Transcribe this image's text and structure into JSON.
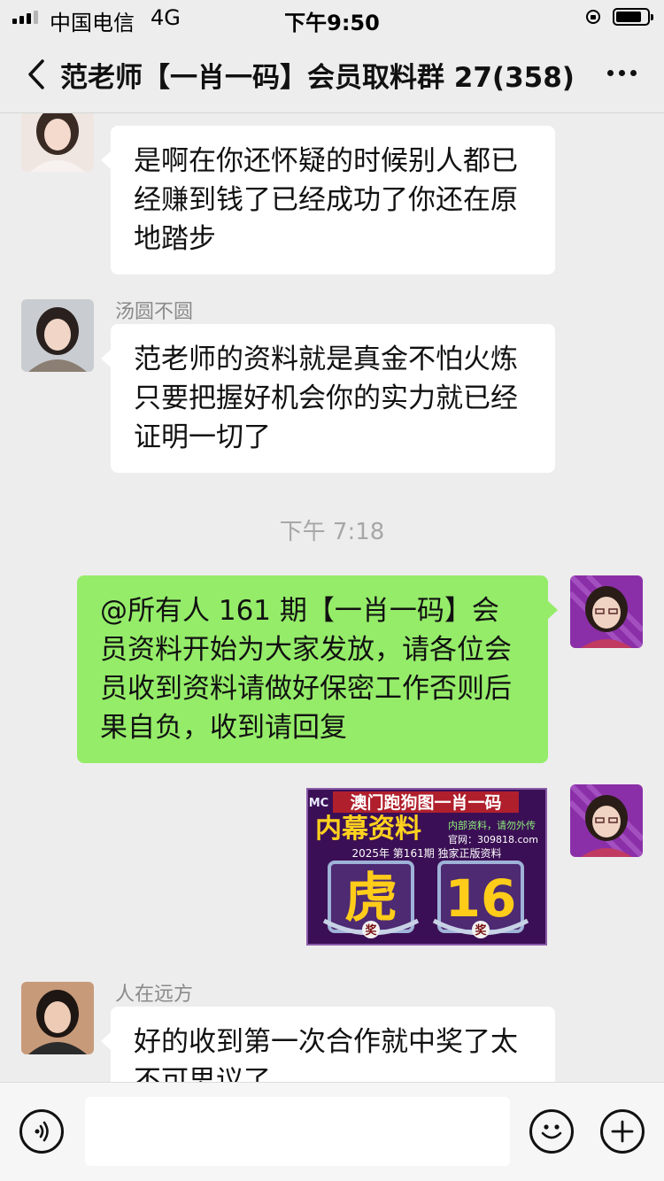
{
  "status_bar": {
    "carrier": "中国电信",
    "network": "4G",
    "time": "下午9:50"
  },
  "header": {
    "title": "范老师【一肖一码】会员取料群 27(358)"
  },
  "messages": [
    {
      "direction": "in",
      "sender": "",
      "text": "是啊在你还怀疑的时候别人都已经赚到钱了已经成功了你还在原地踏步"
    },
    {
      "direction": "in",
      "sender": "汤圆不圆",
      "text": "范老师的资料就是真金不怕火炼只要把握好机会你的实力就已经证明一切了"
    },
    {
      "type": "timestamp",
      "text": "下午 7:18"
    },
    {
      "direction": "out",
      "text": "@所有人 161 期【一肖一码】会员资料开始为大家发放，请各位会员收到资料请做好保密工作否则后果自负，收到请回复"
    },
    {
      "direction": "out",
      "type": "image",
      "image_text": {
        "logo": "MC",
        "banner": "澳门跑狗图一肖一码",
        "headline": "内幕资料",
        "slogan": "内部资料，请勿外传",
        "site": "官网：309818.com",
        "subline": "2025年 第161期 独家正版资料",
        "zodiac": "虎",
        "number": "16",
        "prize_left": "奖",
        "prize_right": "奖"
      }
    },
    {
      "direction": "in",
      "sender": "人在远方",
      "text": "好的收到第一次合作就中奖了太不可思议了"
    }
  ],
  "input": {
    "placeholder": ""
  },
  "colors": {
    "background": "#ededed",
    "incoming_bubble": "#ffffff",
    "outgoing_bubble": "#95ec69",
    "timestamp": "#a7a7a7"
  },
  "icons": [
    "back-icon",
    "more-icon",
    "voice-icon",
    "emoji-icon",
    "plus-icon",
    "lock-icon",
    "battery-icon"
  ]
}
